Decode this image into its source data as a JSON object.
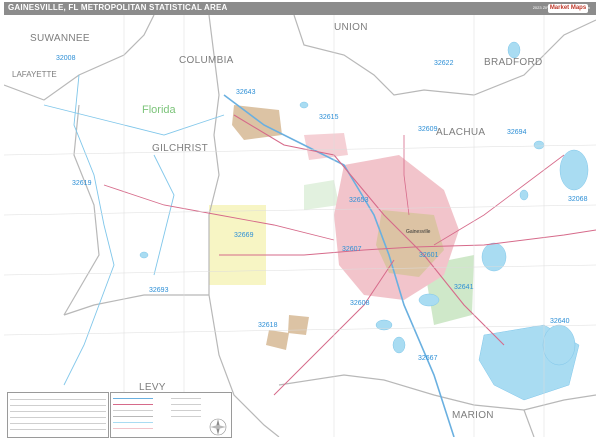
{
  "header": {
    "title": "GAINESVILLE, FL METROPOLITAN STATISTICAL AREA",
    "edition": "2023 ZIP Code Premium Edition"
  },
  "counties": {
    "suwannee": "SUWANNEE",
    "union": "UNION",
    "columbia": "COLUMBIA",
    "bradford": "BRADFORD",
    "alachua": "ALACHUA",
    "gilchrist": "GILCHRIST",
    "levy": "LEVY",
    "marion": "MARION",
    "lafayette": "LAFAYETTE"
  },
  "state_label": "Florida",
  "zips": {
    "z32008": "32008",
    "z32622": "32622",
    "z32643": "32643",
    "z32615": "32615",
    "z32609": "32609",
    "z32694": "32694",
    "z32619": "32619",
    "z32653": "32653",
    "z32068": "32068",
    "z32669": "32669",
    "z32607": "32607",
    "z32608": "32608",
    "z32601": "32601",
    "z32641": "32641",
    "z32693": "32693",
    "z32618": "32618",
    "z32640": "32640",
    "z32667": "32667"
  },
  "cities": {
    "gainesville": "Gainesville"
  },
  "logo_text": "Market Maps",
  "colors": {
    "water": "#a9dcf2",
    "urban_pink": "#f2c4cb",
    "urban_tan": "#dcc3a4",
    "park_green": "#cfe8c9",
    "yellow": "#f5f2b5",
    "road_red": "#d66a8a",
    "highway_blue": "#6ab0e0",
    "county_line": "#b8b8b8"
  }
}
